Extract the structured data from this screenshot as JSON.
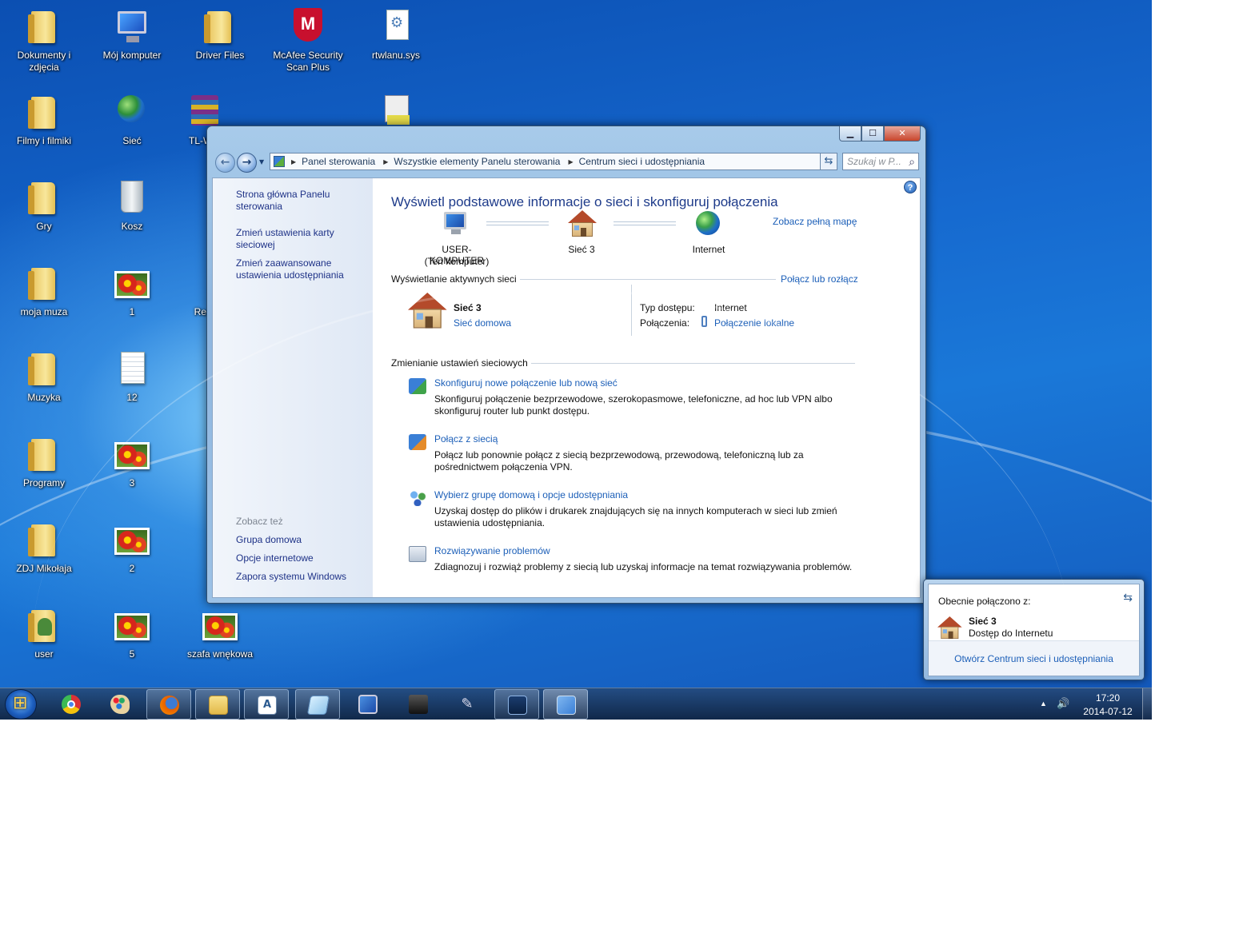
{
  "desktop": {
    "icons": {
      "dokumenty": "Dokumenty i zdjęcia",
      "moj_komputer": "Mój komputer",
      "driver_files": "Driver Files",
      "mcafee": "McAfee Security Scan Plus",
      "rtwlanu": "rtwlanu.sys",
      "filmy": "Filmy i filmiki",
      "siec": "Sieć",
      "tlwn": "TL-WN",
      "gry": "Gry",
      "kosz": "Kosz",
      "moja_muza": "moja muza",
      "photo_1": "1",
      "regi": "Regi",
      "muzyka": "Muzyka",
      "file_12": "12",
      "programy": "Programy",
      "photo_3": "3",
      "zdj_mikolaja": "ZDJ Mikołaja",
      "photo_2": "2",
      "user": "user",
      "photo_5": "5",
      "szafa": "szafa wnękowa"
    }
  },
  "window": {
    "caption_buttons": {
      "minimize": "▁",
      "maximize": "☐",
      "close": "✕"
    },
    "breadcrumb": [
      "Panel sterowania",
      "Wszystkie elementy Panelu sterowania",
      "Centrum sieci i udostępniania"
    ],
    "search_placeholder": "Szukaj w P...",
    "sidebar": {
      "links": [
        "Strona główna Panelu sterowania",
        "Zmień ustawienia karty sieciowej",
        "Zmień zaawansowane ustawienia udostępniania"
      ],
      "see_also_heading": "Zobacz też",
      "see_also": [
        "Grupa domowa",
        "Opcje internetowe",
        "Zapora systemu Windows"
      ]
    },
    "main": {
      "title": "Wyświetl podstawowe informacje o sieci i skonfiguruj połączenia",
      "see_full_map": "Zobacz pełną mapę",
      "map": {
        "computer_name": "USER-KOMPUTER",
        "computer_sub": "(Ten komputer)",
        "network": "Sieć  3",
        "internet": "Internet"
      },
      "active_networks_heading": "Wyświetlanie aktywnych sieci",
      "connect_disconnect": "Połącz lub rozłącz",
      "active": {
        "name": "Sieć  3",
        "type": "Sieć domowa",
        "access_label": "Typ dostępu:",
        "access_value": "Internet",
        "connections_label": "Połączenia:",
        "connections_value": "Połączenie lokalne"
      },
      "change_heading": "Zmienianie ustawień sieciowych",
      "tasks": [
        {
          "title": "Skonfiguruj nowe połączenie lub nową sieć",
          "desc1": "Skonfiguruj połączenie bezprzewodowe, szerokopasmowe, telefoniczne, ad hoc lub VPN albo",
          "desc2": "skonfiguruj router lub punkt dostępu."
        },
        {
          "title": "Połącz z siecią",
          "desc1": "Połącz lub ponownie połącz z siecią bezprzewodową, przewodową, telefoniczną lub za",
          "desc2": "pośrednictwem połączenia VPN."
        },
        {
          "title": "Wybierz grupę domową i opcje udostępniania",
          "desc1": "Uzyskaj dostęp do plików i drukarek znajdujących się na innych komputerach w sieci lub zmień",
          "desc2": "ustawienia udostępniania."
        },
        {
          "title": "Rozwiązywanie problemów",
          "desc1": "Zdiagnozuj i rozwiąż problemy z siecią lub uzyskaj informacje na temat rozwiązywania problemów.",
          "desc2": ""
        }
      ]
    }
  },
  "flyout": {
    "heading": "Obecnie połączono z:",
    "network": "Sieć  3",
    "status": "Dostęp do Internetu",
    "open_center": "Otwórz Centrum sieci i udostępniania"
  },
  "taskbar": {
    "time": "17:20",
    "date": "2014-07-12",
    "tray_arrow": "▲",
    "volume_icon": "🔊"
  },
  "colors": {
    "link": "#1c5fb8",
    "title": "#1e3b8a",
    "sidebar_link": "#1e3287"
  }
}
